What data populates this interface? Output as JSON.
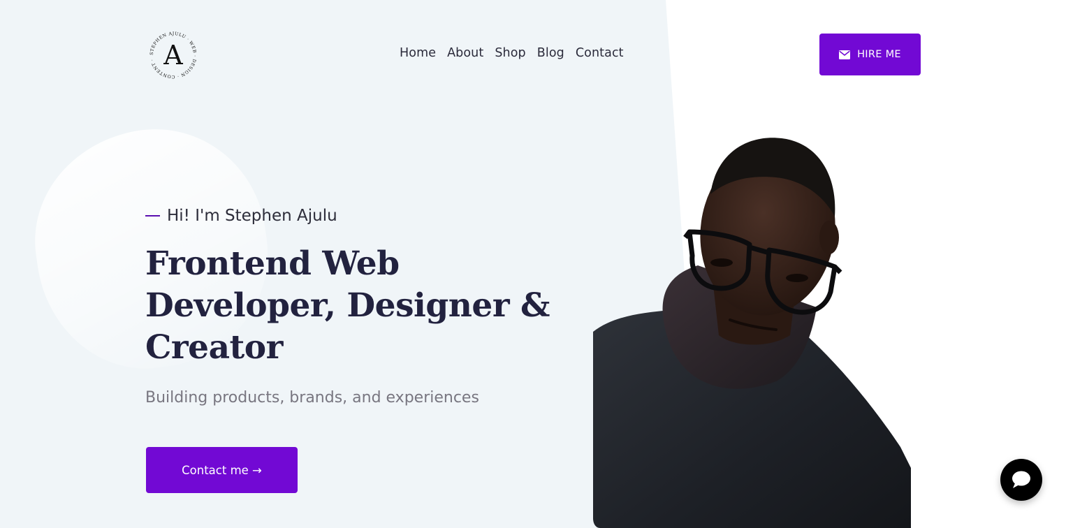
{
  "header": {
    "logo": {
      "letter": "A",
      "ring_text": "STEPHEN AJULU · WEB · DESIGN · CONTENT · MORE ·"
    },
    "nav": [
      {
        "label": "Home"
      },
      {
        "label": "About"
      },
      {
        "label": "Shop"
      },
      {
        "label": "Blog"
      },
      {
        "label": "Contact"
      }
    ],
    "hire_button": {
      "label": "HIRE ME",
      "icon": "envelope-icon"
    }
  },
  "hero": {
    "intro": "Hi! I'm Stephen Ajulu",
    "headline_lines": [
      "Frontend Web",
      "Developer, Designer &",
      "Creator"
    ],
    "subtitle": "Building products, brands, and experiences",
    "cta_label": "Contact me →"
  },
  "chat_widget": {
    "icon": "chat-bubble-icon"
  },
  "colors": {
    "accent": "#7209d4",
    "background_left": "#f0f5f8",
    "headline": "#22223f",
    "subtitle": "#787680"
  }
}
